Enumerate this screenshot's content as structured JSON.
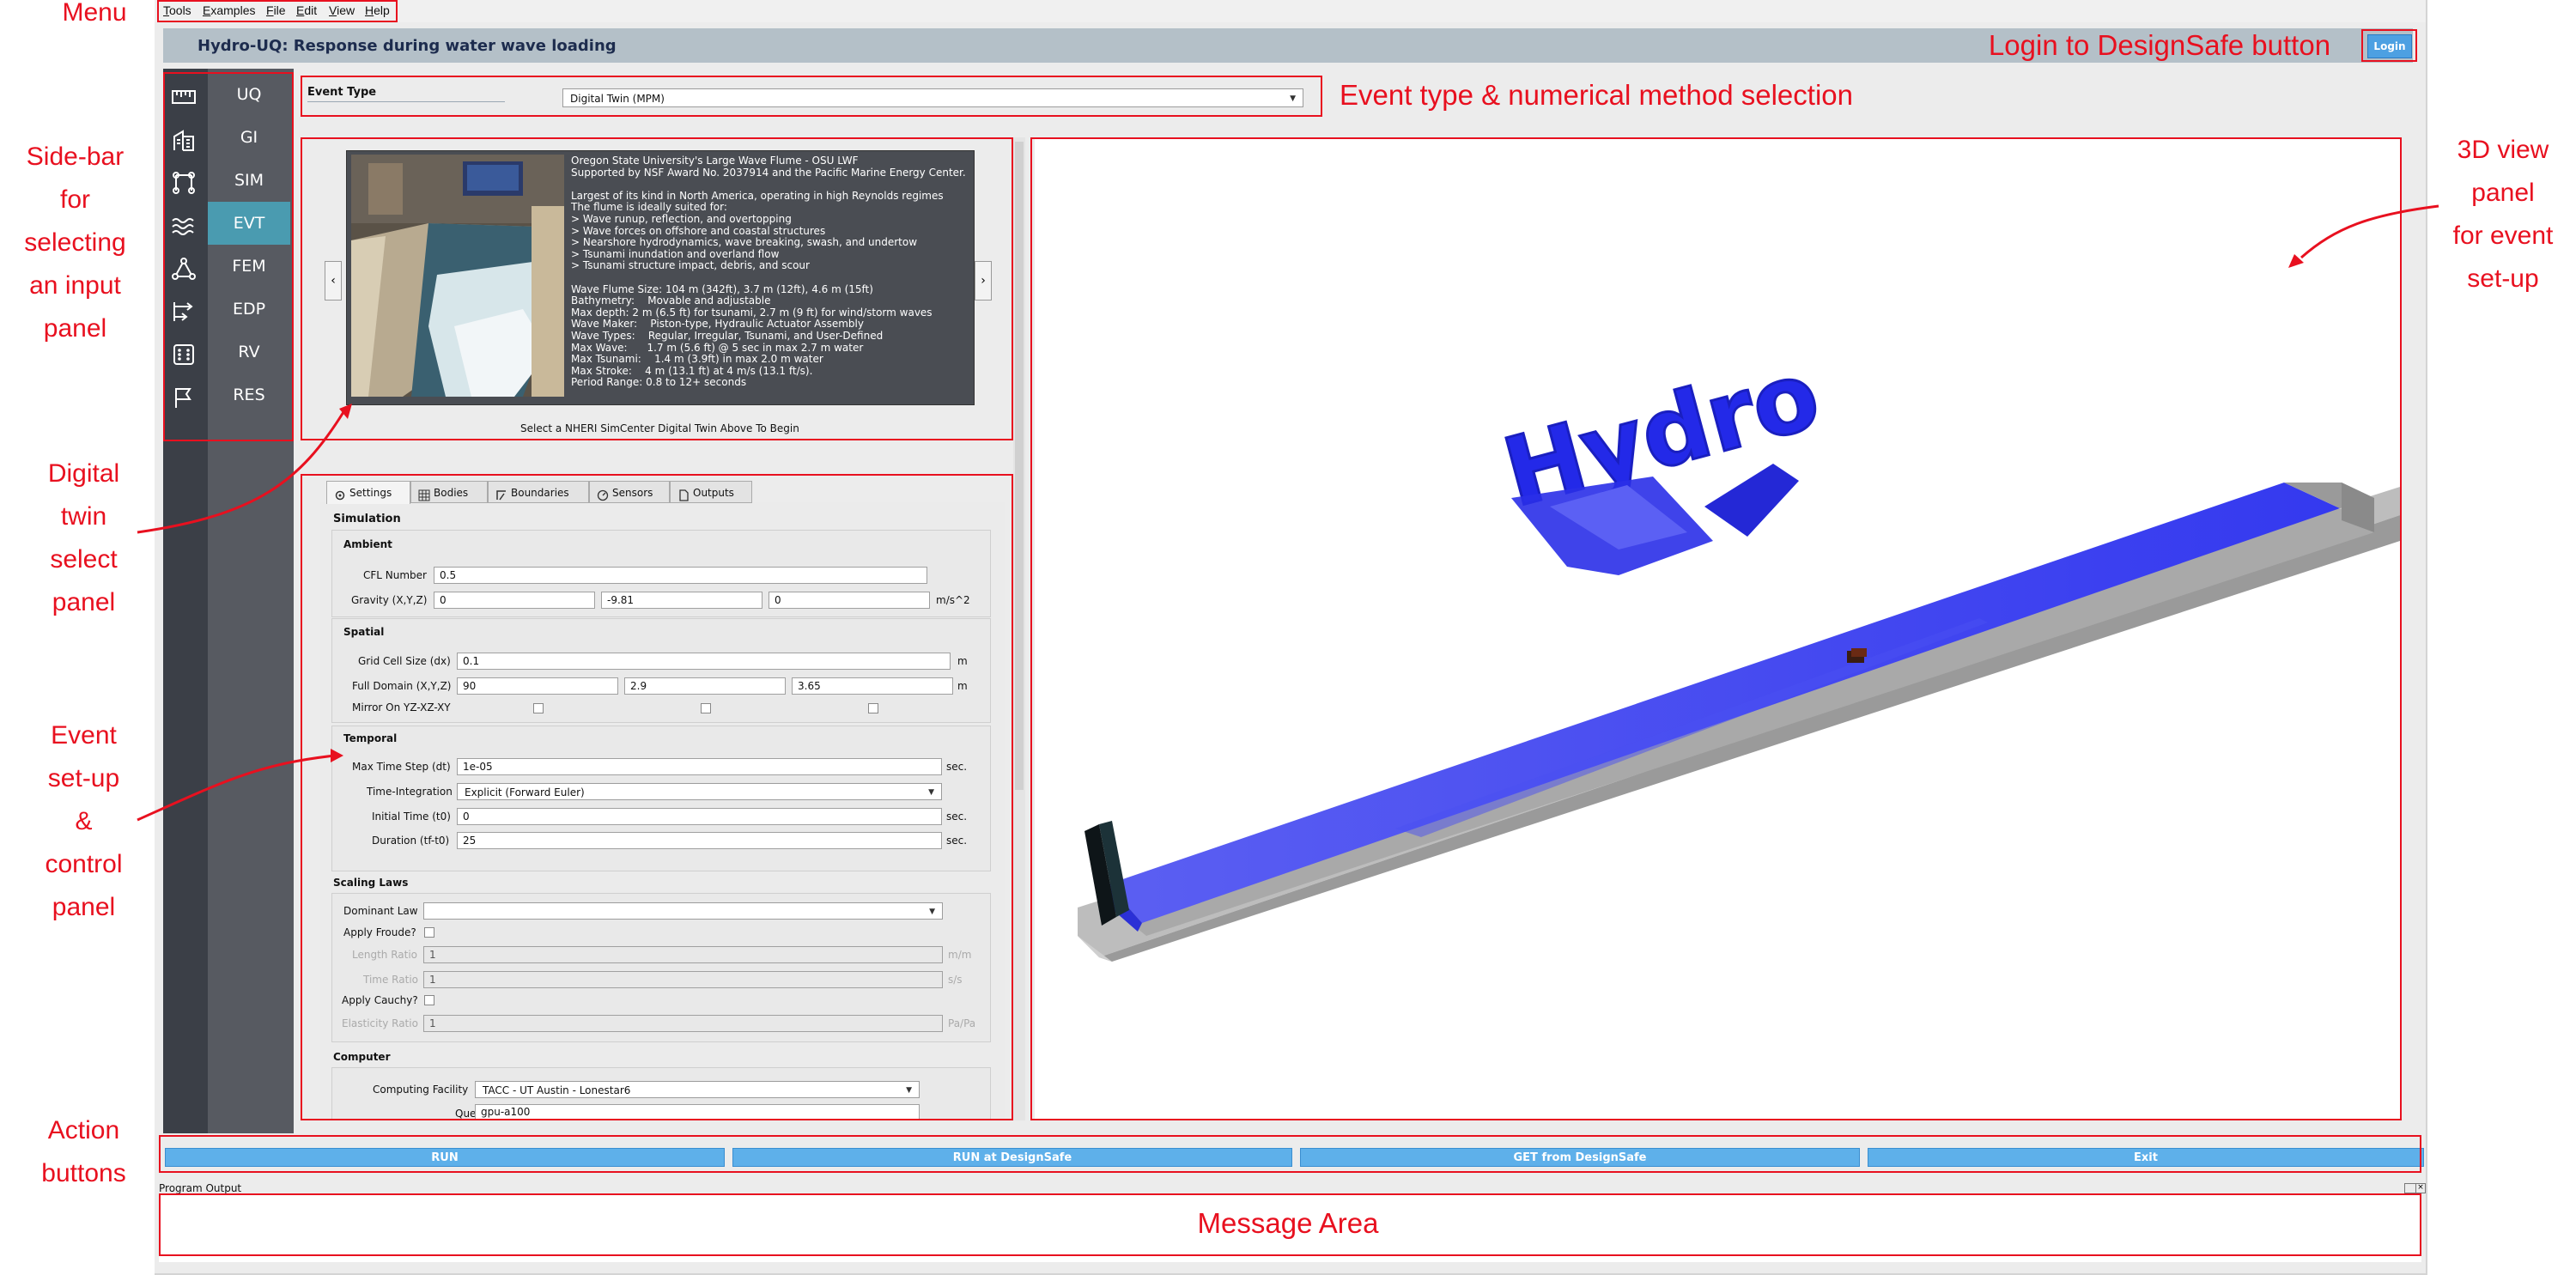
{
  "menu": {
    "items": [
      "Tools",
      "Examples",
      "File",
      "Edit",
      "View",
      "Help"
    ]
  },
  "header": {
    "title": "Hydro-UQ: Response during water wave loading",
    "login_label": "Login"
  },
  "sidebar": {
    "items": [
      {
        "label": "UQ",
        "icon": "ruler-icon"
      },
      {
        "label": "GI",
        "icon": "building-icon"
      },
      {
        "label": "SIM",
        "icon": "frame-icon"
      },
      {
        "label": "EVT",
        "icon": "waves-icon",
        "active": true
      },
      {
        "label": "FEM",
        "icon": "network-icon"
      },
      {
        "label": "EDP",
        "icon": "arrows-right-icon"
      },
      {
        "label": "RV",
        "icon": "dice-icon"
      },
      {
        "label": "RES",
        "icon": "flag-icon"
      }
    ]
  },
  "event_type": {
    "label": "Event Type",
    "value": "Digital Twin (MPM)"
  },
  "digital_twin": {
    "description": "Oregon State University's Large Wave Flume - OSU LWF\nSupported by NSF Award No. 2037914 and the Pacific Marine Energy Center.\n\nLargest of its kind in North America, operating in high Reynolds regimes\nThe flume is ideally suited for:\n> Wave runup, reflection, and overtopping\n> Wave forces on offshore and coastal structures\n> Nearshore hydrodynamics, wave breaking, swash, and undertow\n> Tsunami inundation and overland flow\n> Tsunami structure impact, debris, and scour\n\nWave Flume Size: 104 m (342ft), 3.7 m (12ft), 4.6 m (15ft)\nBathymetry:    Movable and adjustable\nMax depth: 2 m (6.5 ft) for tsunami, 2.7 m (9 ft) for wind/storm waves\nWave Maker:    Piston-type, Hydraulic Actuator Assembly\nWave Types:    Regular, Irregular, Tsunami, and User-Defined\nMax Wave:      1.7 m (5.6 ft) @ 5 sec in max 2.7 m water\nMax Tsunami:    1.4 m (3.9ft) in max 2.0 m water\nMax Stroke:    4 m (13.1 ft) at 4 m/s (13.1 ft/s).\nPeriod Range: 0.8 to 12+ seconds",
    "caption": "Select a NHERI SimCenter Digital Twin Above To Begin",
    "prev_label": "‹",
    "next_label": "›"
  },
  "tabs": [
    "Settings",
    "Bodies",
    "Boundaries",
    "Sensors",
    "Outputs"
  ],
  "settings": {
    "simulation_title": "Simulation",
    "ambient": {
      "title": "Ambient",
      "cfl_label": "CFL Number",
      "cfl": "0.5",
      "gravity_label": "Gravity (X,Y,Z)",
      "gravity": [
        "0",
        "-9.81",
        "0"
      ],
      "gravity_unit": "m/s^2"
    },
    "spatial": {
      "title": "Spatial",
      "dx_label": "Grid Cell Size (dx)",
      "dx": "0.1",
      "dx_unit": "m",
      "domain_label": "Full Domain (X,Y,Z)",
      "domain": [
        "90",
        "2.9",
        "3.65"
      ],
      "domain_unit": "m",
      "mirror_label": "Mirror On YZ-XZ-XY"
    },
    "temporal": {
      "title": "Temporal",
      "dt_label": "Max Time Step (dt)",
      "dt": "1e-05",
      "dt_unit": "sec.",
      "integration_label": "Time-Integration",
      "integration": "Explicit (Forward Euler)",
      "t0_label": "Initial Time (t0)",
      "t0": "0",
      "t0_unit": "sec.",
      "duration_label": "Duration (tf-t0)",
      "duration": "25",
      "duration_unit": "sec."
    },
    "scaling": {
      "title": "Scaling Laws",
      "law_label": "Dominant Law",
      "law": "",
      "froude_label": "Apply Froude?",
      "length_label": "Length Ratio",
      "length": "1",
      "length_unit": "m/m",
      "time_label": "Time Ratio",
      "time": "1",
      "time_unit": "s/s",
      "cauchy_label": "Apply Cauchy?",
      "elasticity_label": "Elasticity Ratio",
      "elasticity": "1",
      "elasticity_unit": "Pa/Pa"
    },
    "computer": {
      "title": "Computer",
      "facility_label": "Computing Facility",
      "facility": "TACC - UT Austin - Lonestar6",
      "queue_label": "Queue",
      "queue": "gpu-a100"
    }
  },
  "view3d": {
    "logo_text": "Hydro"
  },
  "actions": {
    "run": "RUN",
    "run_ds": "RUN at DesignSafe",
    "get_ds": "GET from DesignSafe",
    "exit": "Exit"
  },
  "output": {
    "label": "Program Output"
  },
  "annotations": {
    "menu": "Menu",
    "login": "Login to DesignSafe button",
    "event_type": "Event type & numerical method selection",
    "sidebar": "Side-bar\nfor\nselecting\nan input\npanel",
    "view3d": "3D view\npanel\nfor event\nset-up",
    "digital_twin": "Digital\ntwin\nselect\npanel",
    "event_setup": "Event\nset-up\n&\ncontrol\npanel",
    "actions": "Action\nbuttons",
    "message": "Message Area"
  },
  "colors": {
    "annotation": "#e8101f",
    "sidebar_active": "#4a9bb0",
    "button": "#5eb0ea",
    "water": "#2f34f0",
    "flume": "#a3a3a3"
  }
}
